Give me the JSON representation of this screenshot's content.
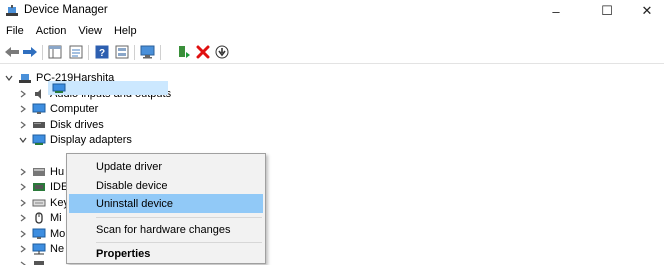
{
  "window": {
    "title": "Device Manager",
    "min_glyph": "–",
    "max_glyph": "☐",
    "close_glyph": "✕"
  },
  "menubar": [
    "File",
    "Action",
    "View",
    "Help"
  ],
  "toolbar": [
    {
      "name": "back-arrow-icon"
    },
    {
      "name": "forward-arrow-icon"
    },
    {
      "name": "show-hide-console-tree-icon"
    },
    {
      "name": "properties-icon"
    },
    {
      "name": "help-icon"
    },
    {
      "name": "view-icon"
    },
    {
      "name": "scan-hardware-icon"
    },
    {
      "name": "update-driver-icon"
    },
    {
      "name": "uninstall-x-icon"
    },
    {
      "name": "download-icon"
    }
  ],
  "tree": {
    "root": "PC-219Harshita",
    "items": [
      {
        "label": "Audio inputs and outputs",
        "icon": "speaker-icon"
      },
      {
        "label": "Computer",
        "icon": "monitor-icon"
      },
      {
        "label": "Disk drives",
        "icon": "disk-icon"
      },
      {
        "label": "Display adapters",
        "icon": "display-adapter-icon",
        "expanded": true
      },
      {
        "label": "Hu",
        "icon": "hid-icon"
      },
      {
        "label": "IDE",
        "icon": "ide-icon"
      },
      {
        "label": "Key",
        "icon": "keyboard-icon"
      },
      {
        "label": "Mi",
        "icon": "mouse-icon"
      },
      {
        "label": "Mo",
        "icon": "monitor-icon"
      },
      {
        "label": "Ne",
        "icon": "network-icon"
      }
    ]
  },
  "context_menu": {
    "items": [
      "Update driver",
      "Disable device",
      "Uninstall device",
      "Scan for hardware changes",
      "Properties"
    ],
    "highlighted_index": 2,
    "bold_index": 4
  },
  "colors": {
    "selection": "#cce8ff",
    "menu_highlight": "#91c9f7",
    "uninstall_red": "#e01010"
  }
}
